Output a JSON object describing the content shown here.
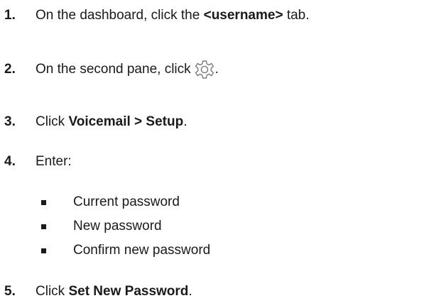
{
  "steps": [
    {
      "number": "1.",
      "before": "On the dashboard, click the ",
      "bold": "<username>",
      "after": " tab."
    },
    {
      "number": "2.",
      "before": "On the second pane, click",
      "icon": "gear-icon",
      "after": "."
    },
    {
      "number": "3.",
      "before": "Click ",
      "bold": "Voicemail > Setup",
      "after": "."
    },
    {
      "number": "4.",
      "before": "Enter:"
    },
    {
      "number": "5.",
      "before": "Click ",
      "bold": "Set New Password",
      "after": "."
    }
  ],
  "bullets": [
    "Current password",
    "New password",
    "Confirm new password"
  ]
}
